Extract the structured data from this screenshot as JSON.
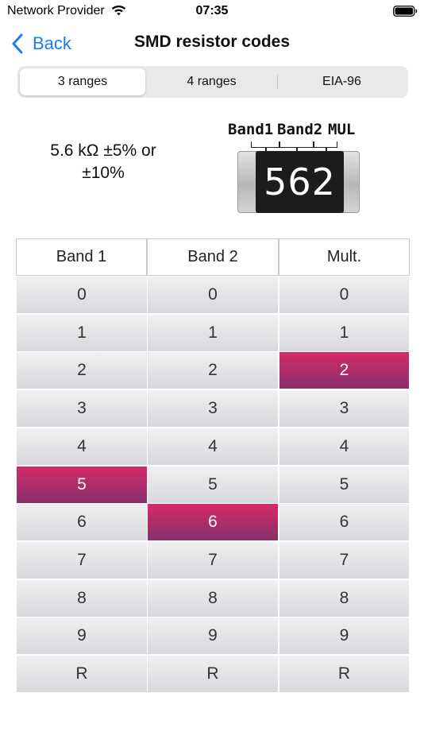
{
  "status_bar": {
    "carrier": "Network Provider",
    "time": "07:35"
  },
  "nav": {
    "back_label": "Back",
    "title": "SMD resistor codes"
  },
  "segments": [
    {
      "label": "3 ranges",
      "selected": true
    },
    {
      "label": "4 ranges",
      "selected": false
    },
    {
      "label": "EIA-96",
      "selected": false
    }
  ],
  "result": {
    "line1": "5.6 kΩ ±5% or",
    "line2": "±10%"
  },
  "resistor": {
    "band_labels": [
      "Band1",
      "Band2",
      "MUL"
    ],
    "code": "562"
  },
  "table": {
    "headers": [
      "Band 1",
      "Band 2",
      "Mult."
    ],
    "rows": [
      "0",
      "1",
      "2",
      "3",
      "4",
      "5",
      "6",
      "7",
      "8",
      "9",
      "R"
    ],
    "selected": {
      "band1": "5",
      "band2": "6",
      "mult": "2"
    }
  },
  "colors": {
    "accent": "#1e7cf2",
    "selected_top": "#d62a6a",
    "selected_bottom": "#87306b"
  }
}
